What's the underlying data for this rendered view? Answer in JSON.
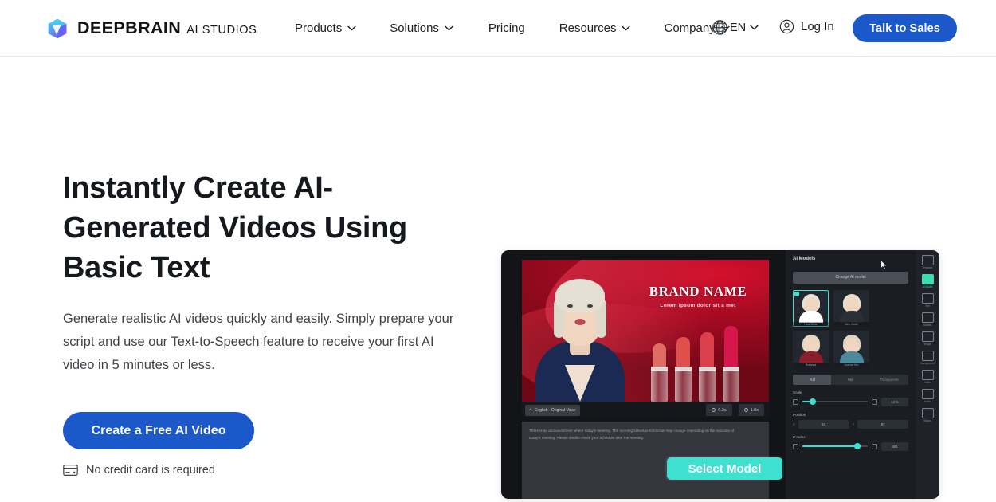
{
  "header": {
    "brand": {
      "name": "DEEPBRAIN",
      "sub": "AI STUDIOS",
      "logo_icon": "cube-logo-icon"
    },
    "nav": [
      {
        "label": "Products",
        "has_chevron": true
      },
      {
        "label": "Solutions",
        "has_chevron": true
      },
      {
        "label": "Pricing",
        "has_chevron": false
      },
      {
        "label": "Resources",
        "has_chevron": true
      },
      {
        "label": "Company",
        "has_chevron": true
      }
    ],
    "language": {
      "label": "EN",
      "icon": "globe-icon"
    },
    "login": {
      "label": "Log In",
      "icon": "user-circle-icon"
    },
    "cta": {
      "label": "Talk to Sales"
    }
  },
  "hero": {
    "title": "Instantly Create AI-Generated Videos Using Basic Text",
    "description": "Generate realistic AI videos quickly and easily. Simply prepare your script and use our Text-to-Speech feature to receive your first AI video in 5 minutes or less.",
    "cta_label": "Create a Free AI Video",
    "note": "No credit card is required",
    "note_icon": "credit-card-icon"
  },
  "preview": {
    "canvas": {
      "brand_title": "BRAND NAME",
      "brand_sub": "Lorem ipsum dolor sit a met"
    },
    "subbar": {
      "language_chip": "English · Original Voice",
      "pill_1": "0.3s",
      "pill_2": "1.0x"
    },
    "script": "There is an announcement where today's meeting. The morning schedule tomorrow may change depending on the outcome of today's meeting. Please double-check your schedule after the meeting.",
    "select_model_label": "Select Model",
    "panel": {
      "title": "AI Models",
      "change_button": "Change AI model",
      "models": [
        {
          "name": "Hina White",
          "selected": true,
          "skin": "#f0d5c0",
          "hair": "#e8e2d4",
          "torso": "#ffffff"
        },
        {
          "name": "John Smith",
          "selected": false,
          "skin": "#f0d5c0",
          "hair": "#e6dfcf",
          "torso": "#2b2f36"
        },
        {
          "name": "Rosanna",
          "selected": false,
          "skin": "#f0d5c0",
          "hair": "#e3d8bd",
          "torso": "#8d1e2c"
        },
        {
          "name": "Joanne Kim",
          "selected": false,
          "skin": "#f0d5c0",
          "hair": "#ddd4c3",
          "torso": "#4c8a9b"
        }
      ],
      "segments": [
        {
          "label": "Full",
          "on": true
        },
        {
          "label": "Half",
          "on": false
        },
        {
          "label": "Transparent",
          "on": false
        }
      ],
      "controls": [
        {
          "label": "Scale",
          "value": "44 %",
          "slider_pct": 14
        },
        {
          "label": "Position",
          "x": "24",
          "y": "67"
        },
        {
          "label": "Z-Index",
          "value": "404",
          "slider_pct": 82
        }
      ]
    },
    "rail": [
      {
        "label": "Template",
        "icon": "template-icon",
        "active": false
      },
      {
        "label": "AI Model",
        "icon": "ai-model-icon",
        "active": true
      },
      {
        "label": "Text",
        "icon": "text-icon",
        "active": false
      },
      {
        "label": "Subtitle",
        "icon": "subtitle-icon",
        "active": false
      },
      {
        "label": "Image",
        "icon": "image-icon",
        "active": false
      },
      {
        "label": "Background",
        "icon": "background-icon",
        "active": false
      },
      {
        "label": "Video",
        "icon": "video-icon",
        "active": false
      },
      {
        "label": "Audio",
        "icon": "audio-icon",
        "active": false
      },
      {
        "label": "Sticker",
        "icon": "sticker-icon",
        "active": false
      }
    ]
  },
  "colors": {
    "brand_blue": "#1b58c9",
    "accent_teal": "#3fe0d0",
    "text_dark": "#15181c",
    "text_body": "#3f4449"
  }
}
